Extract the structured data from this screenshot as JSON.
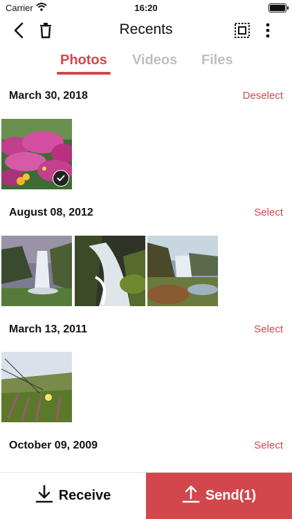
{
  "status_bar": {
    "carrier": "Carrier",
    "time": "16:20"
  },
  "navbar": {
    "title": "Recents"
  },
  "tabs": [
    {
      "label": "Photos",
      "active": true
    },
    {
      "label": "Videos",
      "active": false
    },
    {
      "label": "Files",
      "active": false
    }
  ],
  "sections": [
    {
      "date": "March 30, 2018",
      "action": "Deselect",
      "photo_count": 1,
      "selected": [
        true
      ]
    },
    {
      "date": "August 08, 2012",
      "action": "Select",
      "photo_count": 3
    },
    {
      "date": "March 13, 2011",
      "action": "Select",
      "photo_count": 1
    },
    {
      "date": "October 09, 2009",
      "action": "Select"
    }
  ],
  "bottom": {
    "receive_label": "Receive",
    "send_label": "Send(1)"
  },
  "colors": {
    "accent": "#d2474b",
    "inactive_tab": "#bfbfbf"
  }
}
